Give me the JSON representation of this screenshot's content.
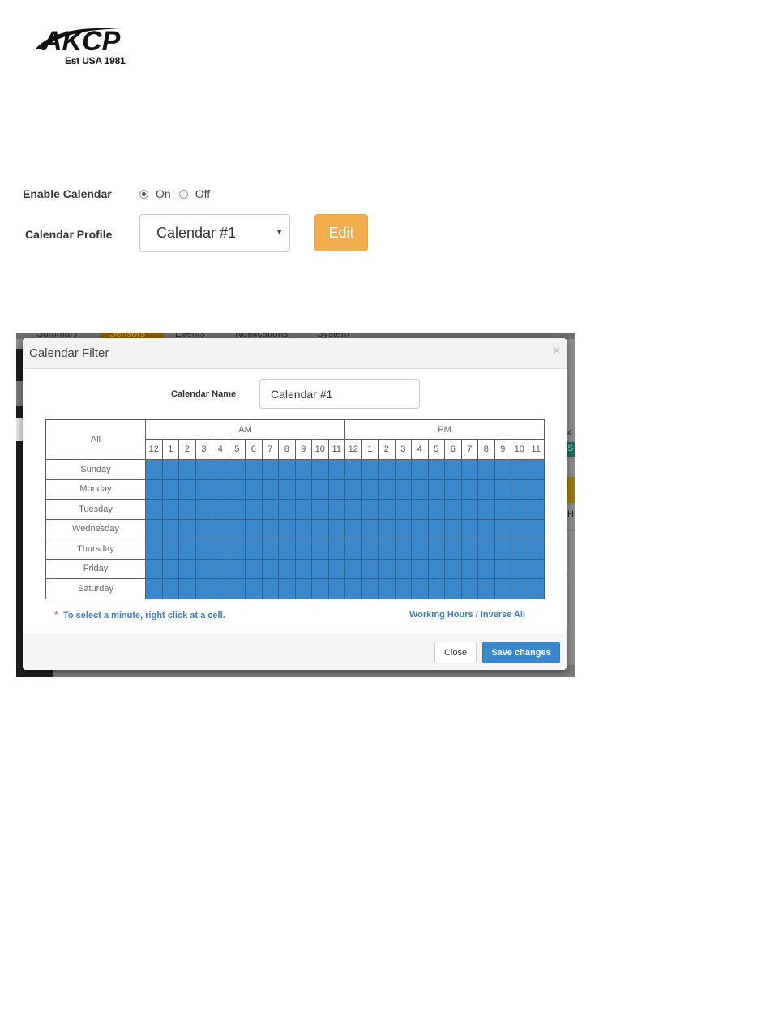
{
  "logo": {
    "brand": "AKCP",
    "tagline": "Est USA 1981",
    "color": "#111111"
  },
  "settings": {
    "enable_label": "Enable Calendar",
    "on_label": "On",
    "off_label": "Off",
    "enabled": "On",
    "profile_label": "Calendar Profile",
    "profile_value": "Calendar #1",
    "edit_label": "Edit",
    "edit_color": "#f0ad4e"
  },
  "background_tabs": [
    "Summary",
    "Sensors",
    "Events",
    "Notifications",
    "System"
  ],
  "background_right": {
    "top_text": "4",
    "badge_text": "S",
    "mid_text": "H"
  },
  "modal": {
    "title": "Calendar Filter",
    "close_symbol": "×",
    "calendar_name_label": "Calendar Name",
    "calendar_name_value": "Calendar #1",
    "all_label": "All",
    "am_label": "AM",
    "pm_label": "PM",
    "am_hours": [
      "12",
      "1",
      "2",
      "3",
      "4",
      "5",
      "6",
      "7",
      "8",
      "9",
      "10",
      "11"
    ],
    "pm_hours": [
      "12",
      "1",
      "2",
      "3",
      "4",
      "5",
      "6",
      "7",
      "8",
      "9",
      "10",
      "11"
    ],
    "days": [
      "Sunday",
      "Monday",
      "Tuesday",
      "Wednesday",
      "Thursday",
      "Friday",
      "Saturday"
    ],
    "selected_color": "#3b88cc",
    "footnote_star": "*",
    "footnote": "To select a minute, right click at a cell.",
    "working_hours_link": "Working Hours / Inverse All",
    "close_button": "Close",
    "save_button": "Save changes",
    "save_color": "#3b88cc"
  }
}
